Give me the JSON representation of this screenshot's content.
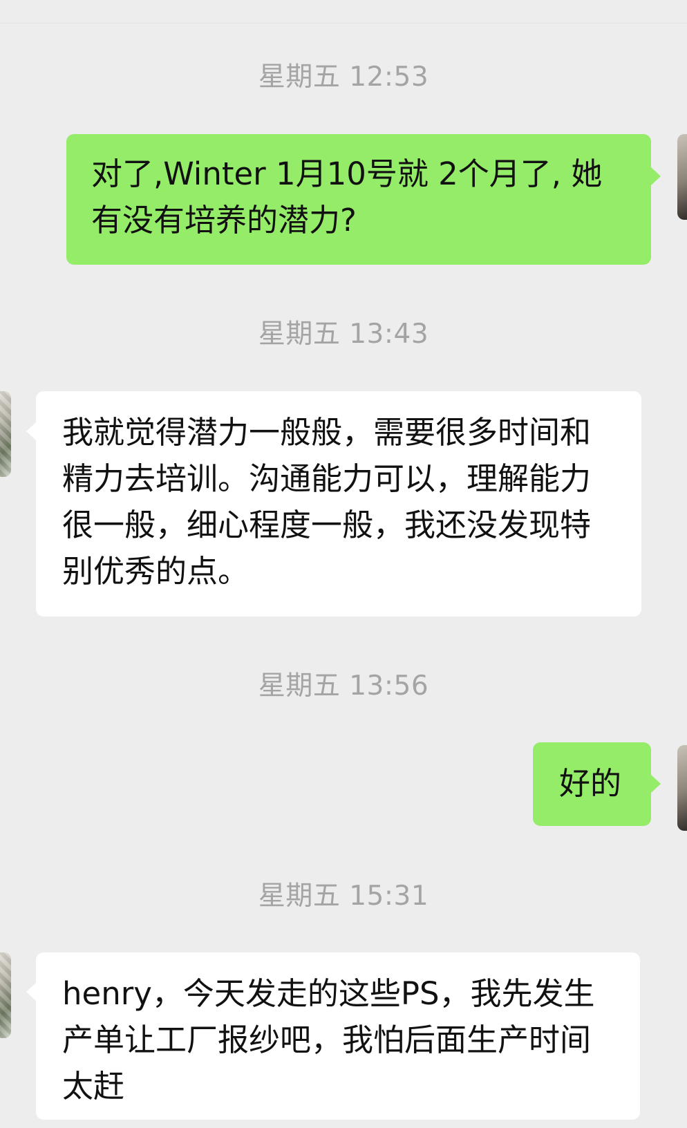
{
  "messages": [
    {
      "timestamp": "星期五 12:53",
      "direction": "outgoing",
      "text": "对了,Winter 1月10号就 2个月了, 她有没有培养的潜力?"
    },
    {
      "timestamp": "星期五 13:43",
      "direction": "incoming",
      "text": "我就觉得潜力一般般，需要很多时间和精力去培训。沟通能力可以，理解能力很一般，细心程度一般，我还没发现特别优秀的点。"
    },
    {
      "timestamp": "星期五 13:56",
      "direction": "outgoing",
      "text": "好的"
    },
    {
      "timestamp": "星期五 15:31",
      "direction": "incoming",
      "text": "henry，今天发走的这些PS，我先发生产单让工厂报纱吧，我怕后面生产时间太赶"
    }
  ],
  "colors": {
    "background": "#ededed",
    "outgoing_bubble": "#95ec69",
    "incoming_bubble": "#ffffff",
    "timestamp_text": "#a4a4a4",
    "message_text": "#111111"
  }
}
